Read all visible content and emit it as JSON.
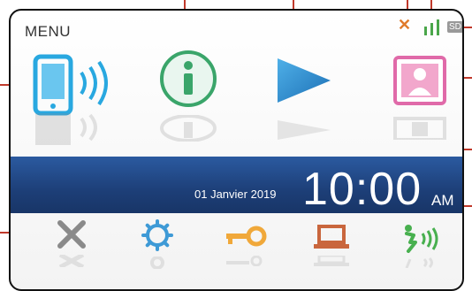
{
  "menu": {
    "title": "MENU"
  },
  "status": {
    "sd_label": "SD"
  },
  "apps": {
    "phone": {
      "name": "phone-icon"
    },
    "info": {
      "name": "info-icon"
    },
    "play": {
      "name": "play-icon"
    },
    "contacts": {
      "name": "contacts-icon"
    }
  },
  "clock": {
    "date": "01 Janvier 2019",
    "time": "10:00",
    "ampm": "AM"
  },
  "bottom": {
    "close": {
      "name": "close-icon"
    },
    "settings": {
      "name": "gear-icon"
    },
    "key": {
      "name": "key-icon"
    },
    "device": {
      "name": "laptop-icon"
    },
    "voice": {
      "name": "voice-icon"
    }
  },
  "colors": {
    "accent_blue": "#1f4b8f",
    "callout_red": "#c0392b"
  }
}
